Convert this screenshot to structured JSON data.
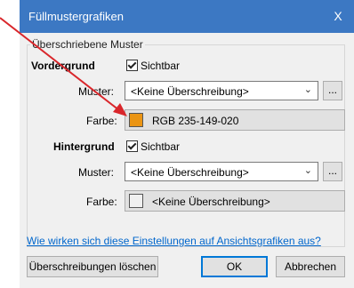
{
  "window": {
    "title": "Füllmustergrafiken",
    "close_glyph": "X"
  },
  "group": {
    "caption": "Überschriebene Muster",
    "foreground": {
      "heading": "Vordergrund",
      "visible_label": "Sichtbar",
      "visible_checked": true,
      "pattern_label": "Muster:",
      "pattern_value": "<Keine Überschreibung>",
      "color_label": "Farbe:",
      "color_value": "RGB 235-149-020",
      "color_hex": "#eb9514"
    },
    "background": {
      "heading": "Hintergrund",
      "visible_label": "Sichtbar",
      "visible_checked": true,
      "pattern_label": "Muster:",
      "pattern_value": "<Keine Überschreibung>",
      "color_label": "Farbe:",
      "color_value": "<Keine Überschreibung>",
      "color_hex": "#f0f0f0"
    },
    "dots_label": "..."
  },
  "help_link": "Wie wirken sich diese Einstellungen auf Ansichtsgrafiken aus?",
  "buttons": {
    "clear": "Überschreibungen löschen",
    "ok": "OK",
    "cancel": "Abbrechen"
  },
  "colors": {
    "title_bar": "#3c78c3",
    "annotation_arrow": "#d9262b",
    "link": "#0066cc"
  }
}
